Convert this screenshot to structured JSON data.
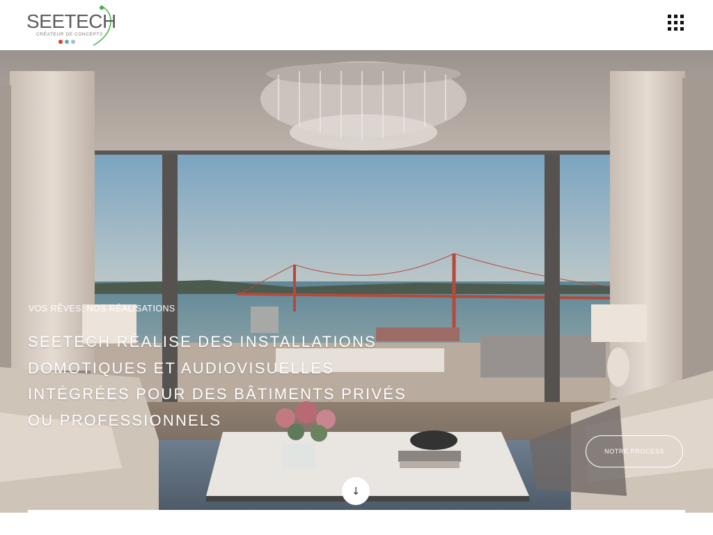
{
  "brand": {
    "name": "SEETECH",
    "tagline": "CRÉATEUR DE CONCEPTS",
    "colors": {
      "green": "#3fae49",
      "red": "#e2382a",
      "teal": "#5bb3a3",
      "blue": "#9bbde0",
      "text": "#5c5c5c"
    }
  },
  "header": {
    "menu_icon": "grid-menu-icon"
  },
  "hero": {
    "eyebrow": "VOS RÊVES, NOS RÉALISATIONS",
    "title_lines": [
      "SEETECH RÉALISE DES INSTALLATIONS",
      "DOMOTIQUES ET AUDIOVISUELLES",
      "INTÉGRÉES POUR DES BÂTIMENTS PRIVÉS",
      "OU PROFESSIONNELS"
    ],
    "cta_label": "NOTRE PROCESS",
    "scroll_icon": "arrow-down-icon",
    "scroll_symbol": "↓"
  }
}
